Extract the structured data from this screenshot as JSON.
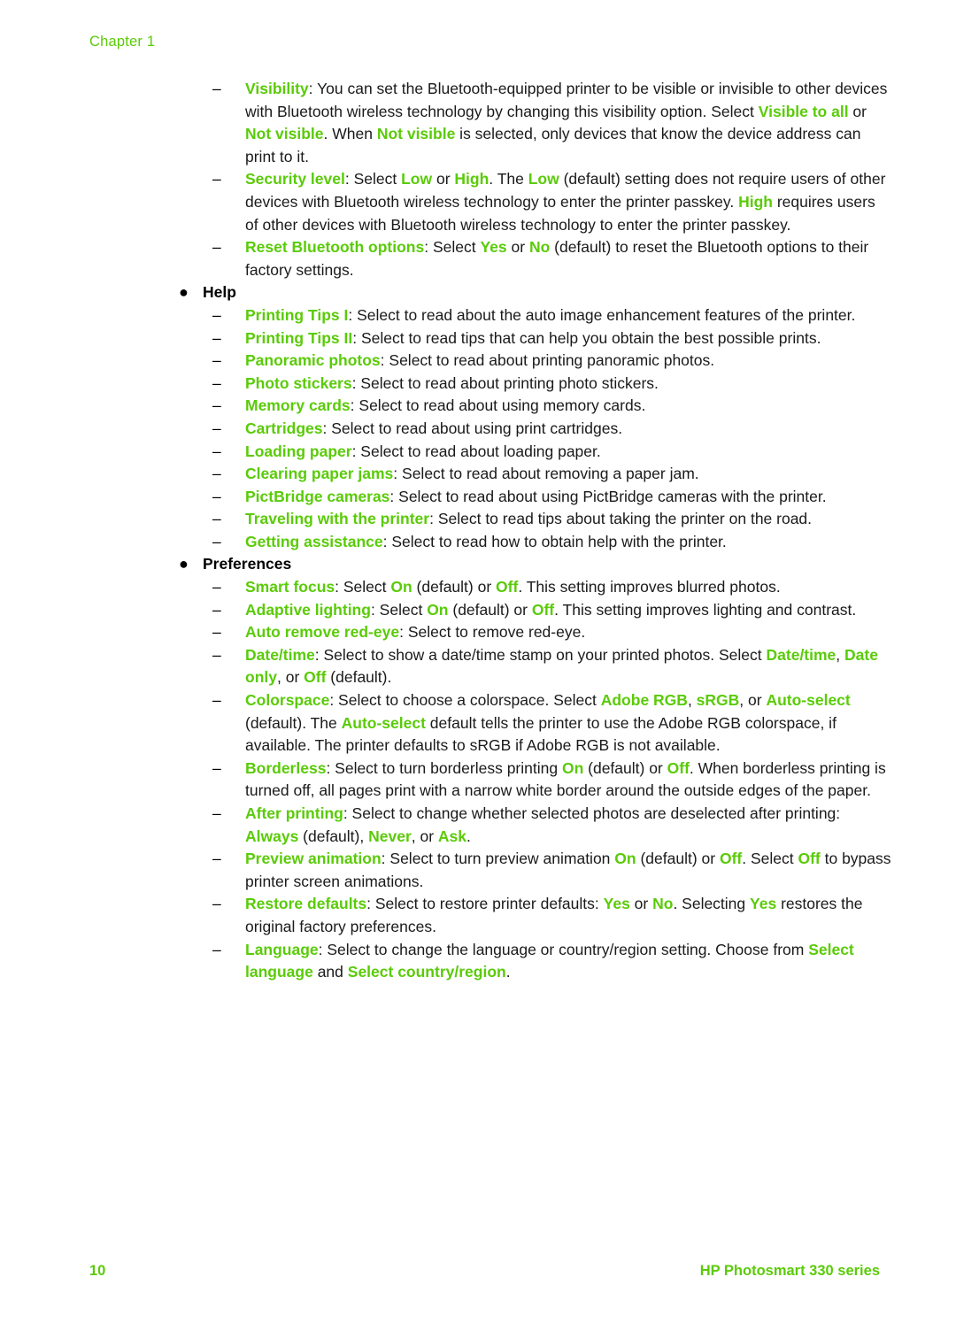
{
  "header": {
    "chapter": "Chapter 1"
  },
  "colors": {
    "accent_green": "#5ACB08",
    "body_text": "#1a1a1a",
    "page_background": "#ffffff"
  },
  "footer": {
    "page_number": "10",
    "product": "HP Photosmart 330 series"
  },
  "blocks": [
    {
      "kind": "dash",
      "name": "visibility",
      "html": "<b class=\"hl\">Visibility</b>: You can set the Bluetooth-equipped printer to be visible or invisible to other devices with Bluetooth wireless technology by changing this visibility option. Select <b class=\"hl\">Visible to all</b> or <b class=\"hl\">Not visible</b>. When <b class=\"hl\">Not visible</b> is selected, only devices that know the device address can print to it."
    },
    {
      "kind": "dash",
      "name": "security-level",
      "html": "<b class=\"hl\">Security level</b>: Select <b class=\"hl\">Low</b> or <b class=\"hl\">High</b>. The <b class=\"hl\">Low</b> (default) setting does not require users of other devices with Bluetooth wireless technology to enter the printer passkey. <b class=\"hl\">High</b> requires users of other devices with Bluetooth wireless technology to enter the printer passkey."
    },
    {
      "kind": "dash",
      "name": "reset-bluetooth-options",
      "html": "<b class=\"hl\">Reset Bluetooth options</b>: Select <b class=\"hl\">Yes</b> or <b class=\"hl\">No</b> (default) to reset the Bluetooth options to their factory settings."
    },
    {
      "kind": "bullet",
      "name": "help",
      "label": "Help"
    },
    {
      "kind": "dash",
      "name": "printing-tips-1",
      "html": "<b class=\"hl\">Printing Tips I</b>: Select to read about the auto image enhancement features of the printer."
    },
    {
      "kind": "dash",
      "name": "printing-tips-2",
      "html": "<b class=\"hl\">Printing Tips II</b>: Select to read tips that can help you obtain the best possible prints."
    },
    {
      "kind": "dash",
      "name": "panoramic-photos",
      "html": "<b class=\"hl\">Panoramic photos</b>: Select to read about printing panoramic photos."
    },
    {
      "kind": "dash",
      "name": "photo-stickers",
      "html": "<b class=\"hl\">Photo stickers</b>: Select to read about printing photo stickers."
    },
    {
      "kind": "dash",
      "name": "memory-cards",
      "html": "<b class=\"hl\">Memory cards</b>: Select to read about using memory cards."
    },
    {
      "kind": "dash",
      "name": "cartridges",
      "html": "<b class=\"hl\">Cartridges</b>: Select to read about using print cartridges."
    },
    {
      "kind": "dash",
      "name": "loading-paper",
      "html": "<b class=\"hl\">Loading paper</b>: Select to read about loading paper."
    },
    {
      "kind": "dash",
      "name": "clearing-paper-jams",
      "html": "<b class=\"hl\">Clearing paper jams</b>: Select to read about removing a paper jam."
    },
    {
      "kind": "dash",
      "name": "pictbridge-cameras",
      "html": "<b class=\"hl\">PictBridge cameras</b>: Select to read about using PictBridge cameras with the printer."
    },
    {
      "kind": "dash",
      "name": "traveling-with-the-printer",
      "html": "<b class=\"hl\">Traveling with the printer</b>: Select to read tips about taking the printer on the road."
    },
    {
      "kind": "dash",
      "name": "getting-assistance",
      "html": "<b class=\"hl\">Getting assistance</b>: Select to read how to obtain help with the printer."
    },
    {
      "kind": "bullet",
      "name": "preferences",
      "label": "Preferences"
    },
    {
      "kind": "dash",
      "name": "smart-focus",
      "html": "<b class=\"hl\">Smart focus</b>: Select <b class=\"hl\">On</b> (default) or <b class=\"hl\">Off</b>. This setting improves blurred photos."
    },
    {
      "kind": "dash",
      "name": "adaptive-lighting",
      "html": "<b class=\"hl\">Adaptive lighting</b>: Select <b class=\"hl\">On</b> (default) or <b class=\"hl\">Off</b>. This setting improves lighting and contrast."
    },
    {
      "kind": "dash",
      "name": "auto-remove-red-eye",
      "html": "<b class=\"hl\">Auto remove red-eye</b>: Select to remove red-eye."
    },
    {
      "kind": "dash",
      "name": "date-time",
      "html": "<b class=\"hl\">Date/time</b>: Select to show a date/time stamp on your printed photos. Select <b class=\"hl\">Date/time</b>, <b class=\"hl\">Date only</b>, or <b class=\"hl\">Off</b> (default)."
    },
    {
      "kind": "dash",
      "name": "colorspace",
      "html": "<b class=\"hl\">Colorspace</b>: Select to choose a colorspace. Select <b class=\"hl\">Adobe RGB</b>, <b class=\"hl\">sRGB</b>, or <b class=\"hl\">Auto-select</b> (default). The <b class=\"hl\">Auto-select</b> default tells the printer to use the Adobe RGB colorspace, if available. The printer defaults to sRGB if Adobe RGB is not available."
    },
    {
      "kind": "dash",
      "name": "borderless",
      "html": "<b class=\"hl\">Borderless</b>: Select to turn borderless printing <b class=\"hl\">On</b> (default) or <b class=\"hl\">Off</b>. When borderless printing is turned off, all pages print with a narrow white border around the outside edges of the paper."
    },
    {
      "kind": "dash",
      "name": "after-printing",
      "html": "<b class=\"hl\">After printing</b>: Select to change whether selected photos are deselected after printing: <b class=\"hl\">Always</b> (default), <b class=\"hl\">Never</b>, or <b class=\"hl\">Ask</b>."
    },
    {
      "kind": "dash",
      "name": "preview-animation",
      "html": "<b class=\"hl\">Preview animation</b>: Select to turn preview animation <b class=\"hl\">On</b> (default) or <b class=\"hl\">Off</b>. Select <b class=\"hl\">Off</b> to bypass printer screen animations."
    },
    {
      "kind": "dash",
      "name": "restore-defaults",
      "html": "<b class=\"hl\">Restore defaults</b>: Select to restore printer defaults: <b class=\"hl\">Yes</b> or <b class=\"hl\">No</b>. Selecting <b class=\"hl\">Yes</b> restores the original factory preferences."
    },
    {
      "kind": "dash",
      "name": "language",
      "html": "<b class=\"hl\">Language</b>: Select to change the language or country/region setting. Choose from <b class=\"hl\">Select language</b> and <b class=\"hl\">Select country/region</b>."
    }
  ],
  "markers": {
    "bullet": "●",
    "dash": "–"
  }
}
